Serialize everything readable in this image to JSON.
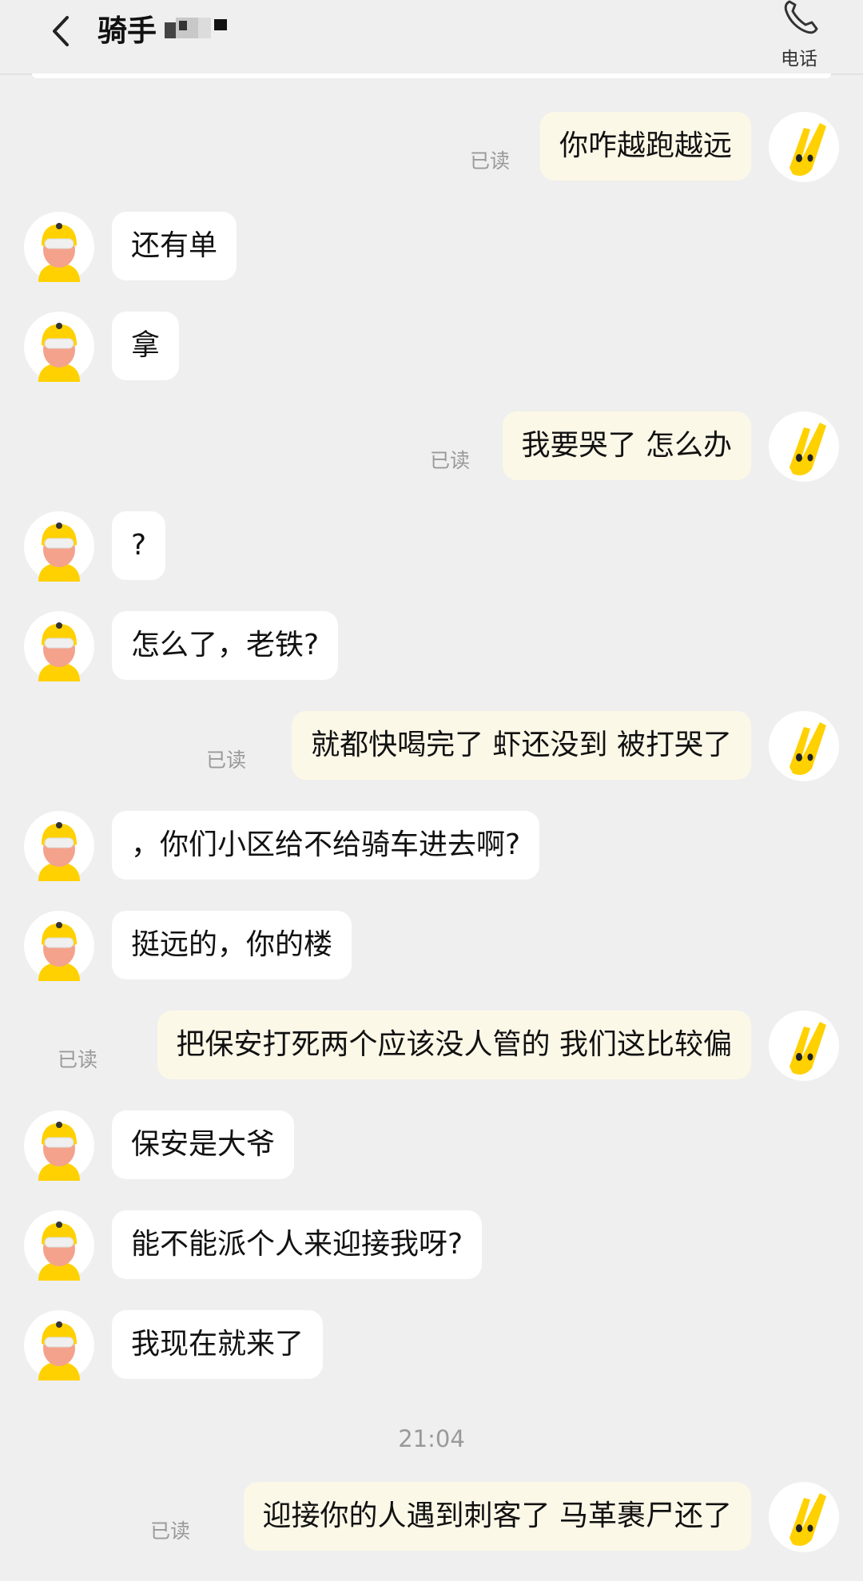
{
  "header": {
    "title": "骑手",
    "phone_label": "电话"
  },
  "messages": [
    {
      "side": "out",
      "text": "你咋越跑越远",
      "status": "已读"
    },
    {
      "side": "in",
      "text": "还有单"
    },
    {
      "side": "in",
      "text": "拿"
    },
    {
      "side": "out",
      "text": "我要哭了 怎么办",
      "status": "已读"
    },
    {
      "side": "in",
      "text": "?"
    },
    {
      "side": "in",
      "text": "怎么了，老铁?"
    },
    {
      "side": "out",
      "text": "就都快喝完了 虾还没到 被打哭了",
      "status": "已读"
    },
    {
      "side": "in",
      "text": "，你们小区给不给骑车进去啊?"
    },
    {
      "side": "in",
      "text": "挺远的，你的楼"
    },
    {
      "side": "out",
      "text": "把保安打死两个应该没人管的 我们这比较偏",
      "status": "已读"
    },
    {
      "side": "in",
      "text": "保安是大爷"
    },
    {
      "side": "in",
      "text": "能不能派个人来迎接我呀?"
    },
    {
      "side": "in",
      "text": "我现在就来了"
    },
    {
      "side": "out",
      "text": "迎接你的人遇到刺客了 马革裹尸还了",
      "status": "已读"
    }
  ],
  "timestamp": "21:04",
  "icons": {
    "back": "chevron-left-icon",
    "phone": "phone-icon",
    "rider_avatar": "rider-avatar",
    "user_avatar": "yellow-hand-avatar"
  },
  "colors": {
    "background": "#efefef",
    "incoming_bubble": "#ffffff",
    "outgoing_bubble": "#fcf8e8",
    "brand_yellow": "#ffd100"
  }
}
